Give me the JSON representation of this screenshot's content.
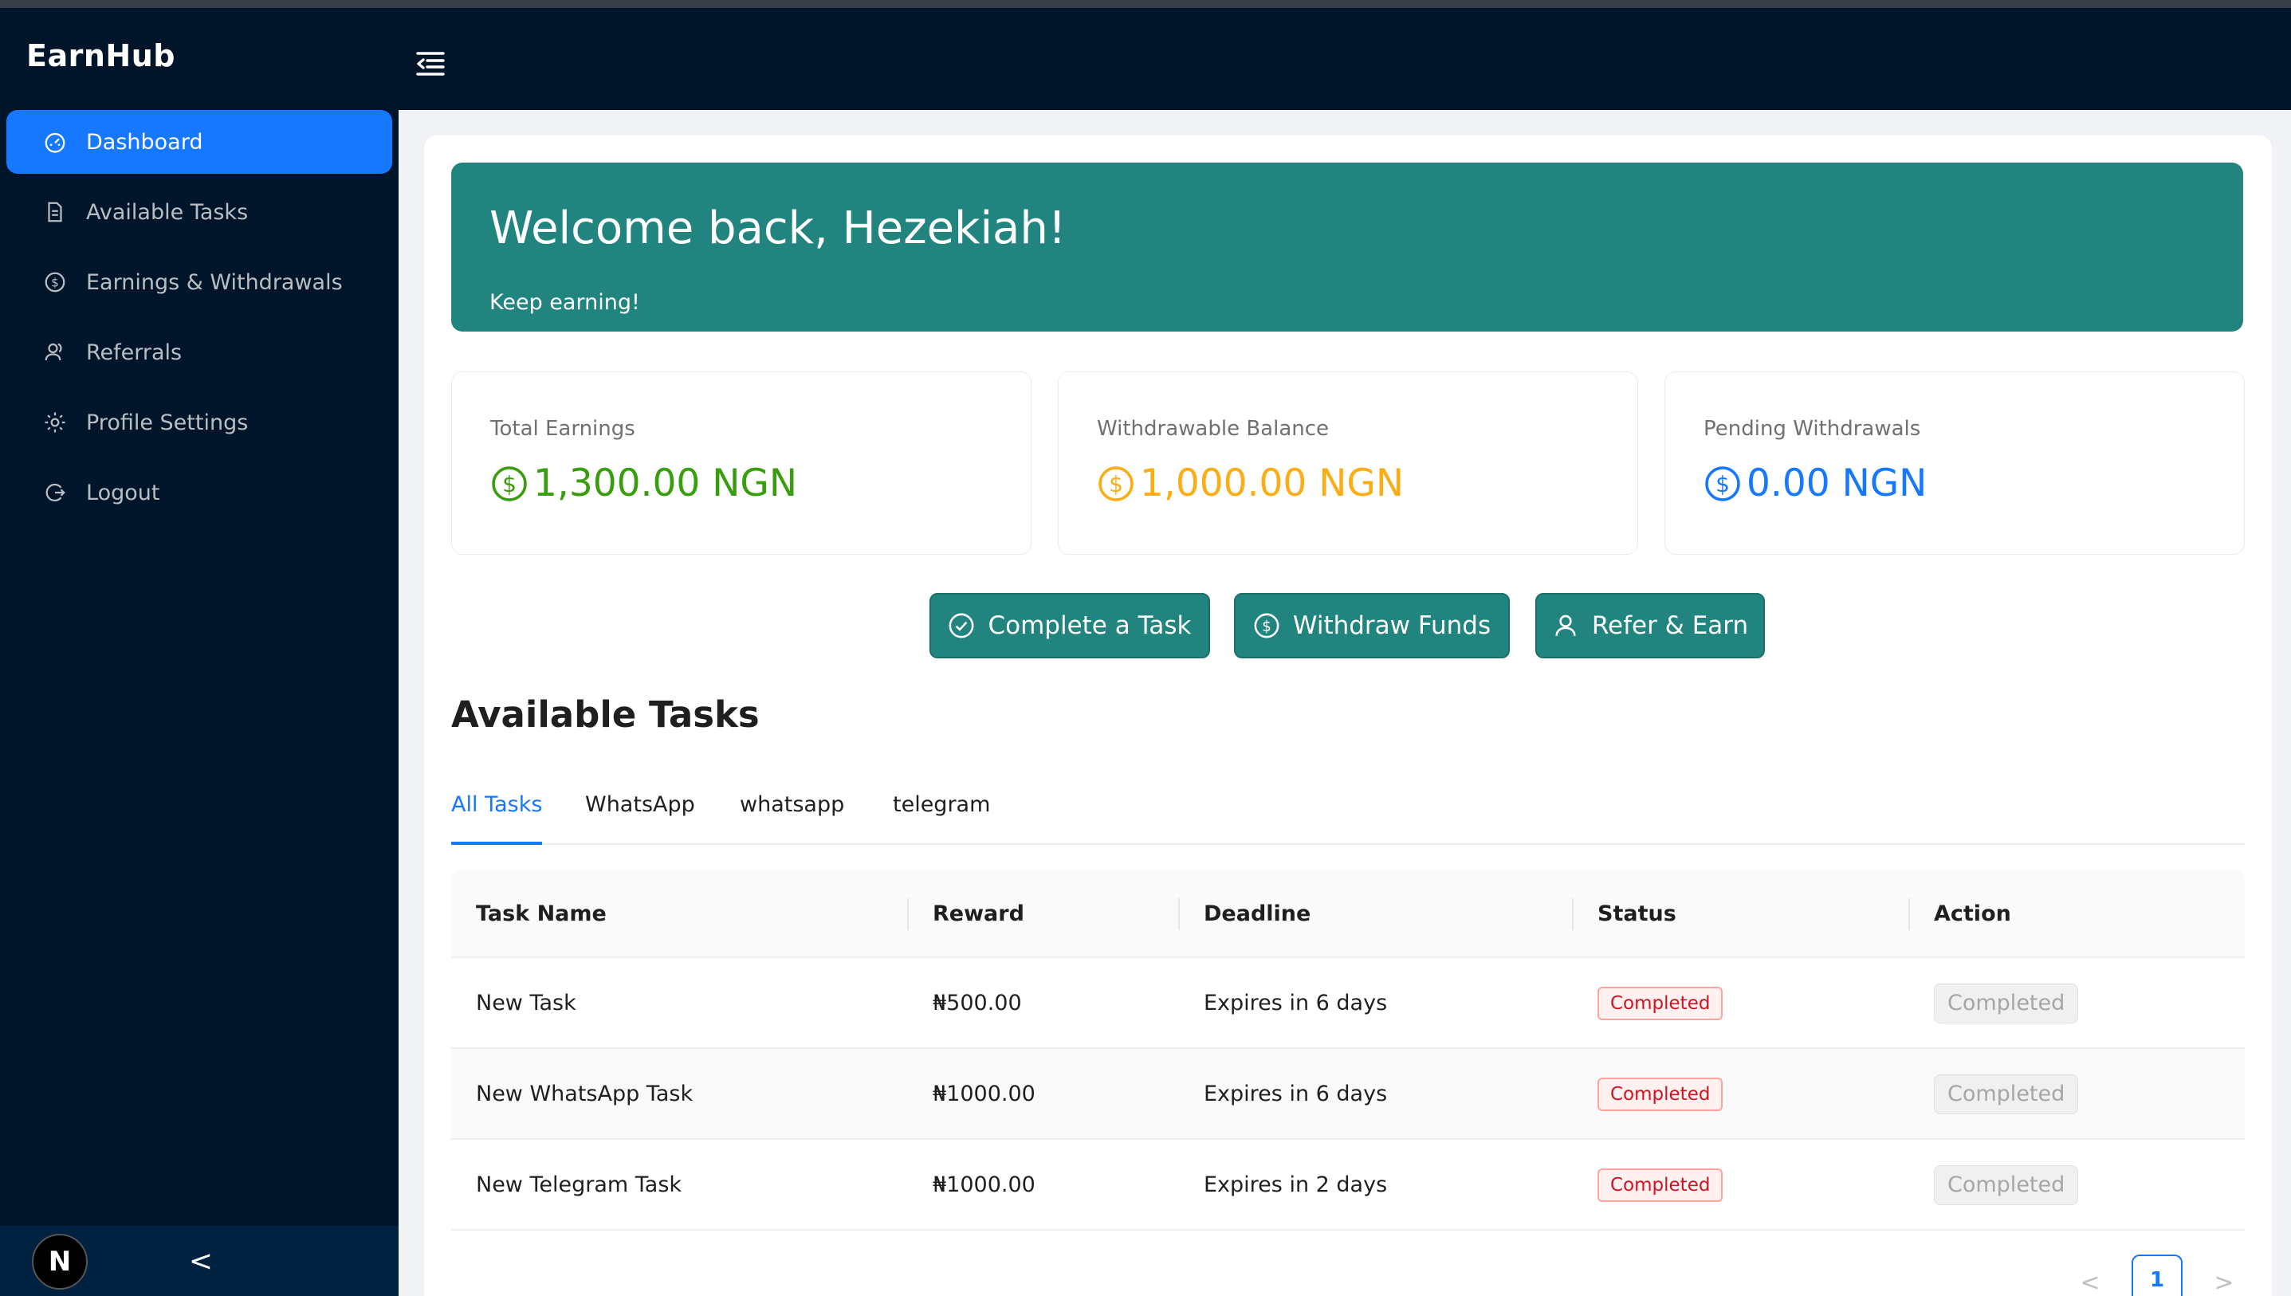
{
  "app": {
    "brand": "EarnHub"
  },
  "sidebar": {
    "items": [
      {
        "label": "Dashboard",
        "icon": "dashboard-icon",
        "active": true
      },
      {
        "label": "Available Tasks",
        "icon": "file-icon",
        "active": false
      },
      {
        "label": "Earnings & Withdrawals",
        "icon": "dollar-circle-icon",
        "active": false
      },
      {
        "label": "Referrals",
        "icon": "users-icon",
        "active": false
      },
      {
        "label": "Profile Settings",
        "icon": "gear-icon",
        "active": false
      },
      {
        "label": "Logout",
        "icon": "logout-icon",
        "active": false
      }
    ],
    "footer": {
      "avatar_letter": "N",
      "collapse_glyph": "<"
    }
  },
  "welcome": {
    "title": "Welcome back, Hezekiah!",
    "subtitle": "Keep earning!"
  },
  "stats": [
    {
      "label": "Total Earnings",
      "value": "1,300.00 NGN",
      "color": "#389e0d"
    },
    {
      "label": "Withdrawable Balance",
      "value": "1,000.00 NGN",
      "color": "#faad14"
    },
    {
      "label": "Pending Withdrawals",
      "value": "0.00 NGN",
      "color": "#1677ff"
    }
  ],
  "actions": [
    {
      "label": "Complete a Task",
      "icon": "check-circle-icon"
    },
    {
      "label": "Withdraw Funds",
      "icon": "dollar-circle-icon"
    },
    {
      "label": "Refer & Earn",
      "icon": "user-icon"
    }
  ],
  "tasks": {
    "title": "Available Tasks",
    "tabs": [
      "All Tasks",
      "WhatsApp",
      "whatsapp",
      "telegram"
    ],
    "active_tab": "All Tasks",
    "columns": [
      "Task Name",
      "Reward",
      "Deadline",
      "Status",
      "Action"
    ],
    "rows": [
      {
        "name": "New Task",
        "reward": "₦500.00",
        "deadline": "Expires in 6 days",
        "status": "Completed",
        "action": "Completed"
      },
      {
        "name": "New WhatsApp Task",
        "reward": "₦1000.00",
        "deadline": "Expires in 6 days",
        "status": "Completed",
        "action": "Completed"
      },
      {
        "name": "New Telegram Task",
        "reward": "₦1000.00",
        "deadline": "Expires in 2 days",
        "status": "Completed",
        "action": "Completed"
      }
    ]
  },
  "pagination": {
    "current_page": "1",
    "prev_glyph": "<",
    "next_glyph": ">"
  }
}
